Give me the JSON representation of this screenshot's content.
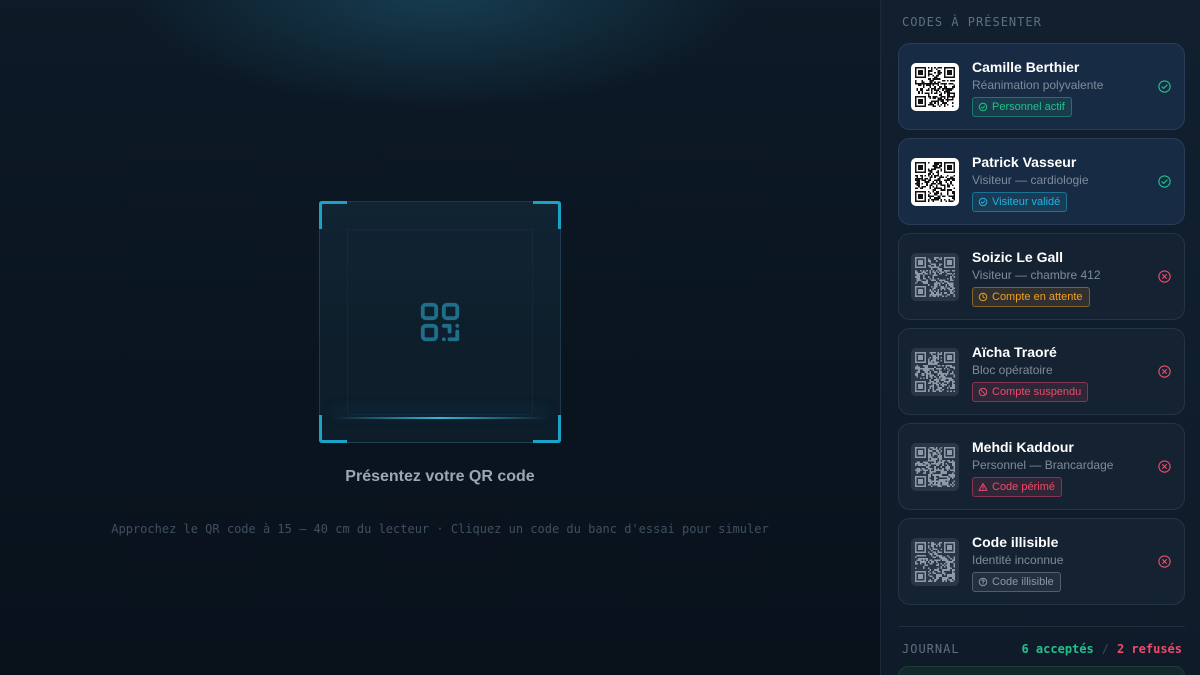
{
  "scanner": {
    "prompt": "Présentez votre QR code",
    "hint": "Approchez le QR code à 15 – 40 cm du lecteur · Cliquez un code du banc d'essai pour simuler",
    "icon": "qr-code-icon",
    "accent": "#1ba3c7"
  },
  "sidebar": {
    "title": "CODES À PRÉSENTER",
    "cards": [
      {
        "name": "Camille Berthier",
        "role": "Réanimation polyvalente",
        "badge": "Personnel actif",
        "badge_icon": "check-circle-icon",
        "badge_color": "#22c08a",
        "status": "check-circle-icon",
        "status_color": "#22c08a"
      },
      {
        "name": "Patrick Vasseur",
        "role": "Visiteur — cardiologie",
        "badge": "Visiteur validé",
        "badge_icon": "check-circle-icon",
        "badge_color": "#1fb6e0",
        "status": "check-circle-icon",
        "status_color": "#22c08a"
      },
      {
        "name": "Soizic Le Gall",
        "role": "Visiteur — chambre 412",
        "badge": "Compte en attente",
        "badge_icon": "clock-icon",
        "badge_color": "#f0a020",
        "status": "x-circle-icon",
        "status_color": "#ef4a6a"
      },
      {
        "name": "Aïcha Traoré",
        "role": "Bloc opératoire",
        "badge": "Compte suspendu",
        "badge_icon": "ban-icon",
        "badge_color": "#ef4a6a",
        "status": "x-circle-icon",
        "status_color": "#ef4a6a"
      },
      {
        "name": "Mehdi Kaddour",
        "role": "Personnel — Brancardage",
        "badge": "Code périmé",
        "badge_icon": "warning-triangle-icon",
        "badge_color": "#ef4a6a",
        "status": "x-circle-icon",
        "status_color": "#ef4a6a"
      },
      {
        "name": "Code illisible",
        "role": "Identité inconnue",
        "badge": "Code illisible",
        "badge_icon": "question-circle-icon",
        "badge_color": "#8a97a5",
        "status": "x-circle-icon",
        "status_color": "#ef4a6a"
      }
    ]
  },
  "journal": {
    "title": "JOURNAL",
    "accepted": "6 acceptés",
    "separator": "/",
    "refused": "2 refusés"
  }
}
